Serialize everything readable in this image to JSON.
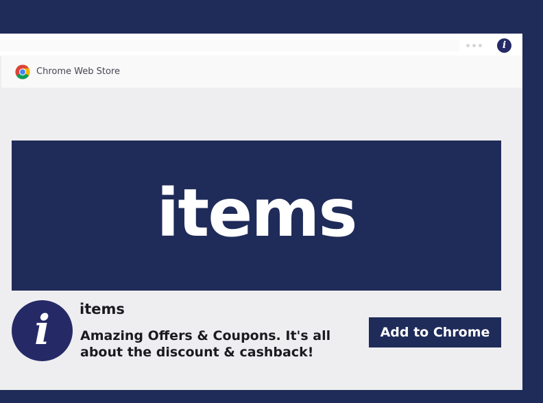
{
  "browser": {
    "info_glyph": "i",
    "menu_icon": "more-horizontal-icon"
  },
  "store": {
    "logo_icon": "chrome-logo-icon",
    "label": "Chrome Web Store"
  },
  "banner": {
    "wordmark": "items"
  },
  "extension": {
    "icon_glyph": "i",
    "name": "items",
    "description": "Amazing Offers & Coupons. It's all about the discount & cashback!",
    "add_button_label": "Add to Chrome"
  },
  "colors": {
    "background": "#1f2b59",
    "accent": "#252a66",
    "button": "#1f2b59"
  }
}
